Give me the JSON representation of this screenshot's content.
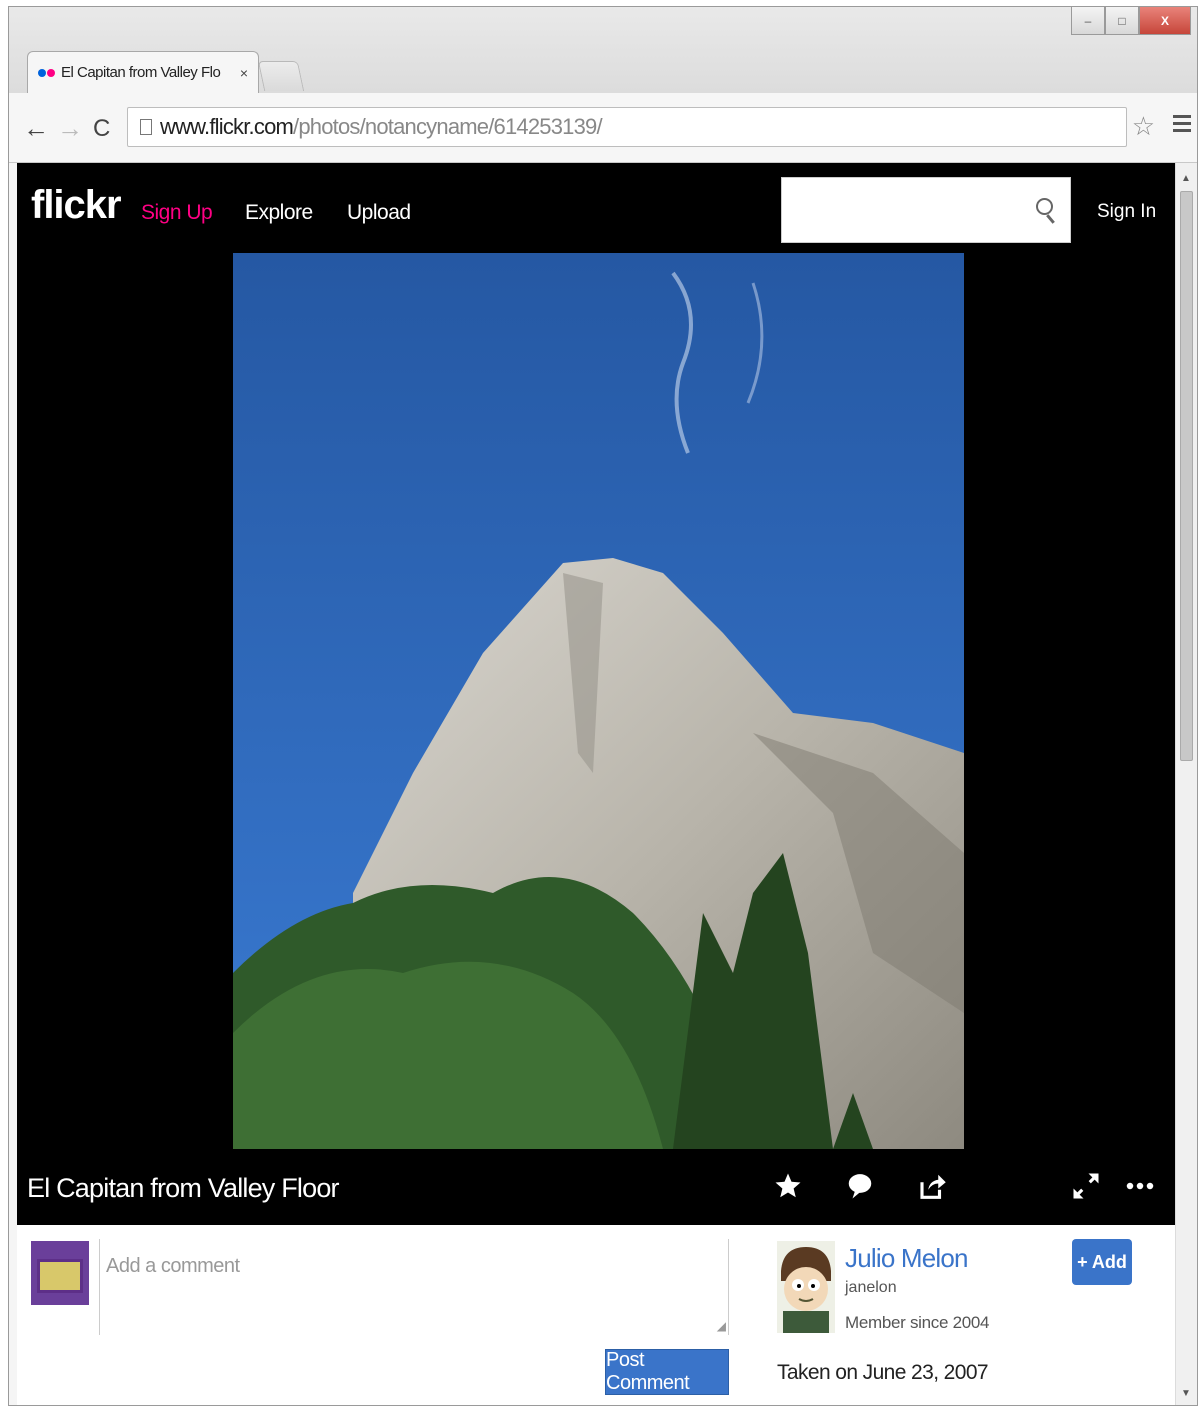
{
  "browser": {
    "tab_title": "El Capitan from Valley Flo",
    "tab_close": "×",
    "url_host": "www.flickr.com",
    "url_path": "/photos/notancyname/614253139/",
    "window_button_max": "□",
    "window_button_close": "X"
  },
  "header": {
    "logo": "flickr",
    "nav": {
      "signup": "Sign Up",
      "explore": "Explore",
      "upload": "Upload"
    },
    "search_placeholder": "",
    "signin": "Sign In"
  },
  "photo": {
    "title": "El Capitan from Valley Floor"
  },
  "comment": {
    "placeholder": "Add a comment",
    "post_label": "Post Comment"
  },
  "owner": {
    "name": "Julio Melon",
    "username": "janelon",
    "member_since": "Member since 2004",
    "add_label": "+ Add"
  },
  "taken_on": "Taken on June 23, 2007",
  "colors": {
    "flickr_pink": "#ff0084",
    "flickr_blue": "#3a74c9",
    "header_bg": "#000000"
  }
}
